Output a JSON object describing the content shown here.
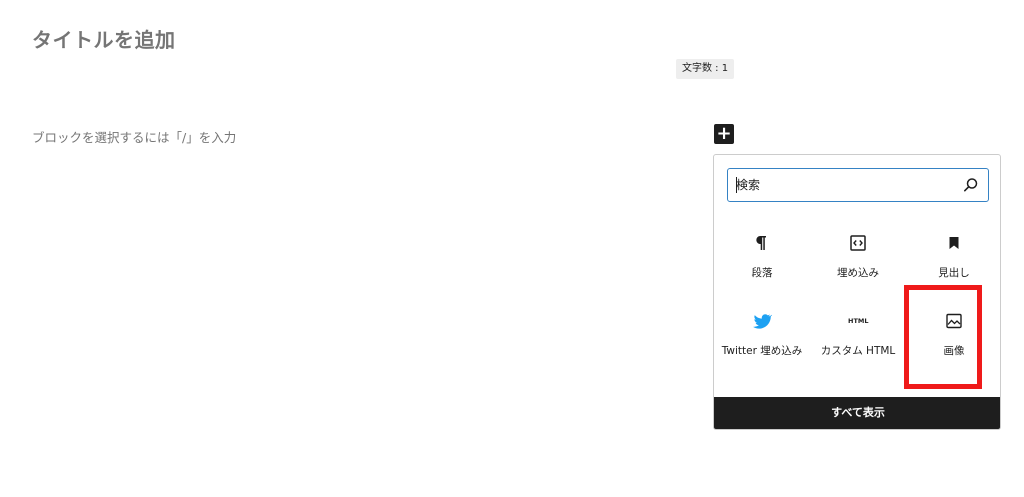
{
  "editor": {
    "title_placeholder": "タイトルを追加",
    "char_count": "文字数 : 1",
    "block_placeholder": "ブロックを選択するには「/」を入力"
  },
  "inserter": {
    "toggle_label": "+",
    "search_placeholder": "検索",
    "blocks": [
      {
        "label": "段落",
        "icon": "paragraph-icon"
      },
      {
        "label": "埋め込み",
        "icon": "embed-icon"
      },
      {
        "label": "見出し",
        "icon": "heading-bookmark-icon"
      },
      {
        "label": "Twitter 埋め込み",
        "icon": "twitter-icon"
      },
      {
        "label": "カスタム HTML",
        "icon": "html-icon",
        "icon_text": "HTML"
      },
      {
        "label": "画像",
        "icon": "image-icon",
        "highlighted": true
      }
    ],
    "show_all_label": "すべて表示"
  },
  "colors": {
    "accent": "#3582c4",
    "twitter": "#1da1f2",
    "highlight": "#ef1a1a",
    "dark": "#1e1e1e"
  }
}
